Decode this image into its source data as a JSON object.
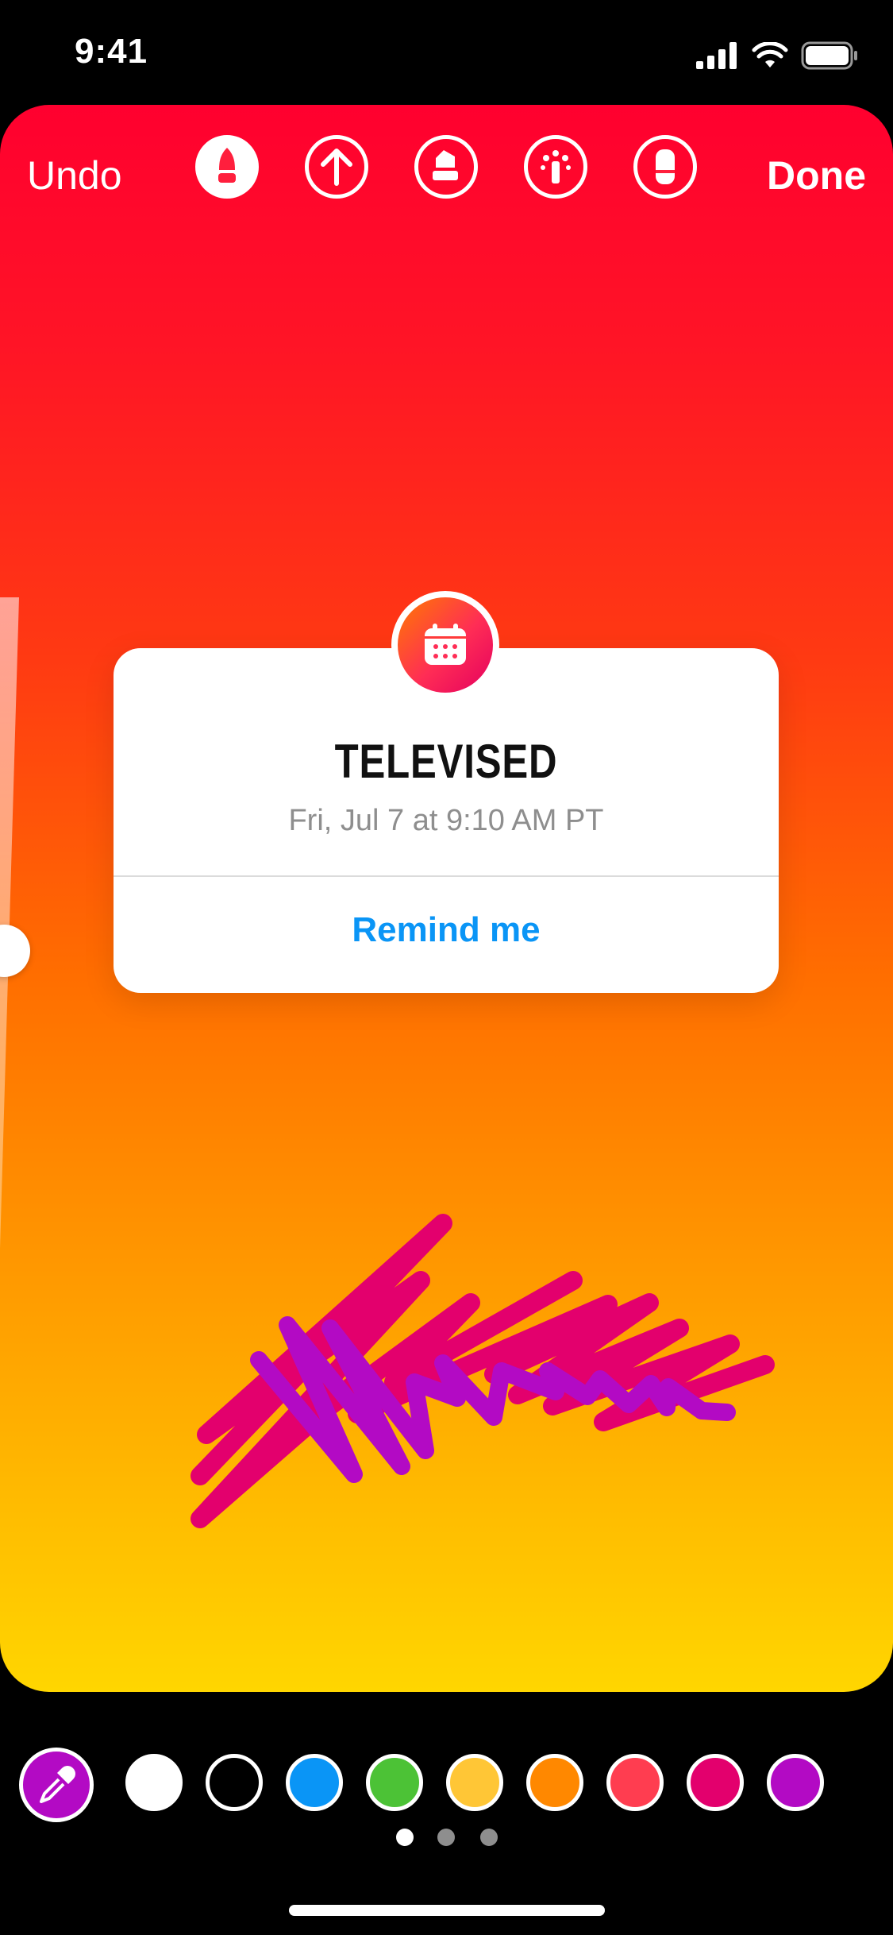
{
  "status_bar": {
    "time": "9:41"
  },
  "toolbar": {
    "undo_label": "Undo",
    "done_label": "Done",
    "tools": [
      "marker-icon",
      "arrow-up-icon",
      "highlighter-icon",
      "neon-icon",
      "eraser-icon"
    ],
    "active_tool": "marker-icon"
  },
  "sticker": {
    "badge_icon": "calendar-icon",
    "title": "TELEVISED",
    "date": "Fri, Jul 7 at 9:10 AM PT",
    "action_label": "Remind me",
    "action_color": "#0A95F6"
  },
  "colors": {
    "gradient_top": "#FF002F",
    "gradient_bottom": "#FFD600",
    "scribble_pink": "#E3006D",
    "scribble_purple": "#B30AC4"
  },
  "palette": {
    "swatches": [
      "#FFFFFF",
      "#000000",
      "#0A95F6",
      "#4CC236",
      "#FFC636",
      "#FF8800",
      "#FF3D50",
      "#E3006D",
      "#B30AC4"
    ],
    "eyedropper_icon": "eyedropper-icon",
    "pages": 3,
    "active_page": 0
  }
}
